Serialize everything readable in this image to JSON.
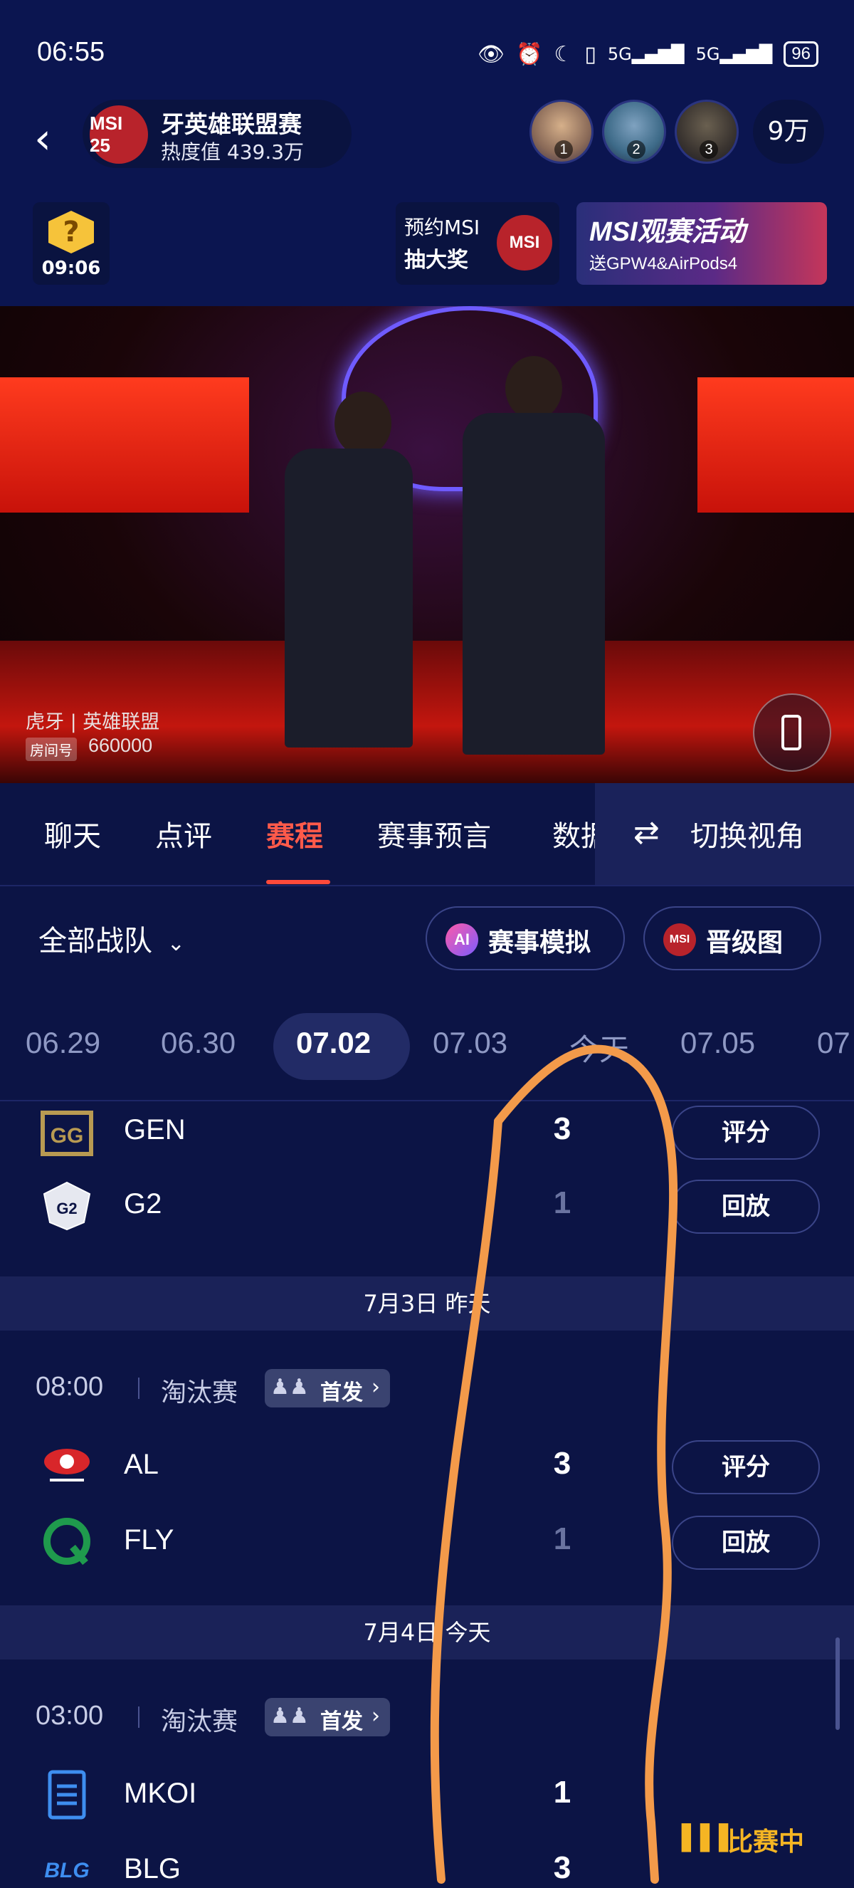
{
  "status_bar": {
    "time": "06:55",
    "battery": "96",
    "icons": [
      "eye-icon",
      "alarm-icon",
      "moon-icon",
      "vibrate-icon",
      "signal-5g-icon",
      "signal-5g-icon"
    ]
  },
  "header": {
    "channel_title": "牙英雄联盟赛",
    "channel_logo_text": "MSI 25",
    "heat": "热度值 439.3万",
    "viewers": [
      {
        "rank": "1"
      },
      {
        "rank": "2"
      },
      {
        "rank": "3"
      }
    ],
    "viewer_count": "9万",
    "quiz_time": "09:06",
    "quiz_symbol": "?",
    "promo1": {
      "line1": "预约MSI",
      "line2": "抽大奖",
      "logo": "MSI"
    },
    "promo2": {
      "line1": "MSI观赛活动",
      "line2": "送GPW4&AirPods4"
    }
  },
  "video": {
    "watermark": "虎牙 | 英雄联盟",
    "room_tag": "房间号",
    "room_number": "660000"
  },
  "tabs": {
    "items": [
      "聊天",
      "点评",
      "赛程",
      "赛事预言",
      "数据"
    ],
    "active_index": 2,
    "switch_view": "切换视角"
  },
  "filter": {
    "team_filter": "全部战队",
    "simulate": {
      "icon": "AI",
      "label": "赛事模拟"
    },
    "bracket": {
      "icon": "MSI",
      "label": "晋级图"
    }
  },
  "dates": {
    "items": [
      "06.29",
      "06.30",
      "07.02",
      "07.03",
      "今天",
      "07.05",
      "07"
    ],
    "active_index": 2
  },
  "matches": {
    "first": {
      "teams": [
        {
          "name": "GEN",
          "score": "3",
          "button": "评分"
        },
        {
          "name": "G2",
          "score": "1",
          "button": "回放"
        }
      ]
    },
    "day2_header": "7月3日 昨天",
    "second": {
      "time": "08:00",
      "stage": "淘汰赛",
      "lineup": "首发",
      "teams": [
        {
          "name": "AL",
          "score": "3",
          "button": "评分"
        },
        {
          "name": "FLY",
          "score": "1",
          "button": "回放"
        }
      ]
    },
    "day3_header": "7月4日 今天",
    "third": {
      "time": "03:00",
      "stage": "淘汰赛",
      "lineup": "首发",
      "teams": [
        {
          "name": "MKOI",
          "score": "1"
        },
        {
          "name": "BLG",
          "score": "3"
        }
      ]
    }
  },
  "live_indicator": "比赛中",
  "colors": {
    "background": "#0c1445",
    "accent": "#ff4a3a",
    "live": "#f5b523",
    "annotation": "#f39a4a"
  }
}
